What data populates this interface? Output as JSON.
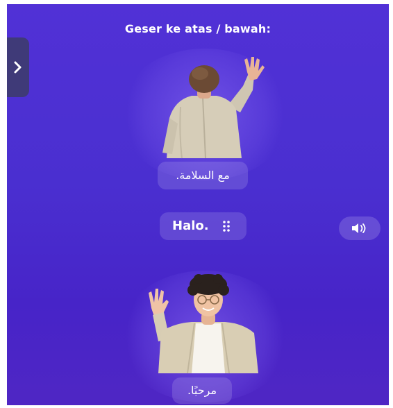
{
  "instruction": "Geser ke atas / bawah:",
  "side_tab": {
    "icon": "chevron-right-icon"
  },
  "cards": {
    "top": {
      "translation": "مع السلامة."
    },
    "middle": {
      "word": "Halo.",
      "drag_icon": "drag-handle-icon"
    },
    "bottom": {
      "translation": "مرحبًا."
    }
  },
  "speaker": {
    "icon": "speaker-icon"
  },
  "colors": {
    "background_top": "#5131d6",
    "background_bottom": "#4724c8",
    "chip_background": "rgba(255,255,255,0.14)",
    "text": "#ffffff"
  }
}
